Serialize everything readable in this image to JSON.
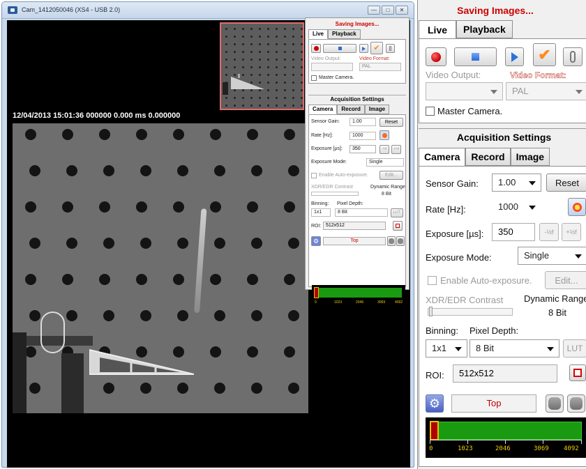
{
  "window": {
    "title": "Cam_1412050046 (XS4 - USB 2.0)",
    "controls": [
      "—",
      "□",
      "✕"
    ]
  },
  "overlay": {
    "timestamp": "12/04/2013 15:01:36 000000 0.000 ms 0.000000"
  },
  "panel": {
    "status": "Saving Images...",
    "tabs": [
      {
        "label": "Live"
      },
      {
        "label": "Playback"
      }
    ],
    "video_output_label": "Video Output:",
    "video_format_label": "Video Format:",
    "video_output_value": "",
    "video_format_value": "PAL",
    "master_camera_label": "Master Camera.",
    "acquisition_title": "Acquisition Settings",
    "acq_tabs": [
      {
        "label": "Camera"
      },
      {
        "label": "Record"
      },
      {
        "label": "Image"
      }
    ],
    "sensor_gain_label": "Sensor Gain:",
    "sensor_gain_value": "1.00",
    "reset_label": "Reset",
    "rate_label": "Rate [Hz]:",
    "rate_value": "1000",
    "exposure_label": "Exposure [µs]:",
    "exposure_value": "350",
    "exposure_half_label": "-½f",
    "exposure_half_plus_label": "+½f",
    "exposure_mode_label": "Exposure Mode:",
    "exposure_mode_value": "Single",
    "auto_exposure_label": "Enable Auto-exposure.",
    "edit_label": "Edit...",
    "xdr_label": "XDR/EDR Contrast",
    "dynamic_range_label": "Dynamic Range",
    "dynamic_range_value": "8 Bit",
    "binning_label": "Binning:",
    "pixel_depth_label": "Pixel Depth:",
    "binning_value": "1x1",
    "pixel_depth_value": "8 Bit",
    "lut_label": "LUT",
    "roi_label": "ROI:",
    "roi_value": "512x512",
    "position_value": "Top",
    "histogram_labels": [
      "0",
      "1023",
      "2046",
      "3069",
      "4092"
    ]
  }
}
